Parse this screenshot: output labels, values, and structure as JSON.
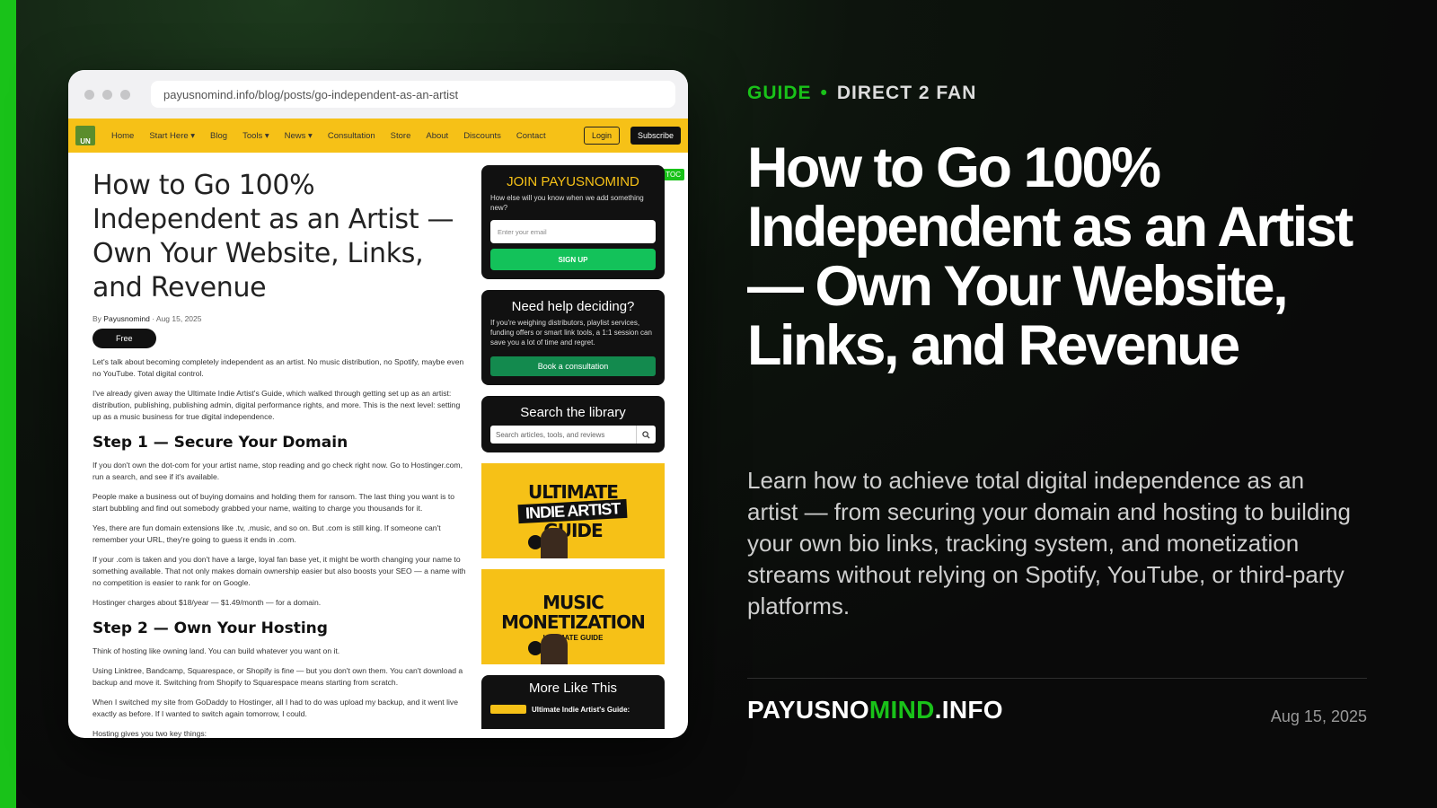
{
  "browser": {
    "url": "payusnomind.info/blog/posts/go-independent-as-an-artist"
  },
  "site_nav": {
    "logo_text": "UN",
    "items": [
      "Home",
      "Start Here ▾",
      "Blog",
      "Tools ▾",
      "News ▾",
      "Consultation",
      "Store",
      "About",
      "Discounts",
      "Contact"
    ],
    "login": "Login",
    "subscribe": "Subscribe"
  },
  "article": {
    "title": "How to Go 100% Independent as an Artist — Own Your Website, Links, and Revenue",
    "byline_prefix": "By",
    "author": "Payusnomind",
    "date": "· Aug 15, 2025",
    "badge": "Free",
    "p1": "Let's talk about becoming completely independent as an artist. No music distribution, no Spotify, maybe even no YouTube. Total digital control.",
    "p2": "I've already given away the Ultimate Indie Artist's Guide, which walked through getting set up as an artist: distribution, publishing, publishing admin, digital performance rights, and more. This is the next level: setting up as a music business for true digital independence.",
    "h1": "Step 1 — Secure Your Domain",
    "p3": "If you don't own the dot-com for your artist name, stop reading and go check right now. Go to Hostinger.com, run a search, and see if it's available.",
    "p4": "People make a business out of buying domains and holding them for ransom. The last thing you want is to start bubbling and find out somebody grabbed your name, waiting to charge you thousands for it.",
    "p5": "Yes, there are fun domain extensions like .tv, .music, and so on. But .com is still king. If someone can't remember your URL, they're going to guess it ends in .com.",
    "p6": "If your .com is taken and you don't have a large, loyal fan base yet, it might be worth changing your name to something available. That not only makes domain ownership easier but also boosts your SEO — a name with no competition is easier to rank for on Google.",
    "p7": "Hostinger charges about $18/year — $1.49/month — for a domain.",
    "h2": "Step 2 — Own Your Hosting",
    "p8": "Think of hosting like owning land. You can build whatever you want on it.",
    "p9": "Using Linktree, Bandcamp, Squarespace, or Shopify is fine — but you don't own them. You can't download a backup and move it. Switching from Shopify to Squarespace means starting from scratch.",
    "p10": "When I switched my site from GoDaddy to Hostinger, all I had to do was upload my backup, and it went live exactly as before. If I wanted to switch again tomorrow, I could.",
    "p11": "Hosting gives you two key things:"
  },
  "sidebar": {
    "toc": "☰ TOC",
    "join": {
      "title": "JOIN PAYUSNOMIND",
      "subtitle": "How else will you know when we add something new?",
      "email_placeholder": "Enter your email",
      "button": "SIGN UP"
    },
    "help": {
      "title": "Need help deciding?",
      "subtitle": "If you're weighing distributors, playlist services, funding offers or smart link tools, a 1:1 session can save you a lot of time and regret.",
      "button": "Book a consultation"
    },
    "search": {
      "title": "Search the library",
      "placeholder": "Search articles, tools, and reviews"
    },
    "promo1": {
      "line1": "ULTIMATE",
      "line2": "INDIE ARTIST",
      "line3": "GUIDE"
    },
    "promo2": {
      "line1": "MUSIC",
      "line2": "MONETIZATION",
      "line3": "ULTIMATE GUIDE"
    },
    "more": {
      "title": "More Like This",
      "item1": "Ultimate Indie Artist's Guide:"
    }
  },
  "hero": {
    "tag_primary": "GUIDE",
    "tag_separator": "•",
    "tag_secondary": "DIRECT 2 FAN",
    "title": "How to Go 100% Independent as an Artist — Own Your Website, Links, and Revenue",
    "description": "Learn how to achieve total digital independence as an artist — from securing your domain and hosting to building your own bio links, tracking system, and monetization streams without relying on Spotify, YouTube, or third-party platforms.",
    "brand_part1": "PAYUSNO",
    "brand_part2": "MIND",
    "brand_part3": ".INFO",
    "date": "Aug 15, 2025"
  },
  "colors": {
    "accent": "#19c219",
    "nav_yellow": "#f6c117",
    "background": "#0a0a0a"
  }
}
